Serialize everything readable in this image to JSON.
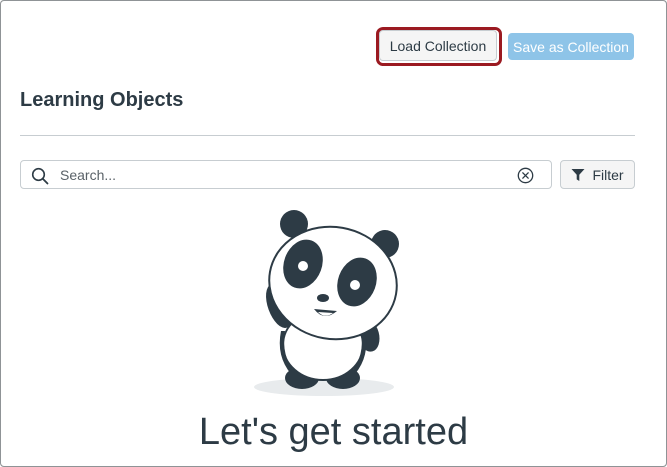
{
  "toolbar": {
    "load_label": "Load Collection",
    "save_label": "Save as Collection"
  },
  "page": {
    "title": "Learning Objects"
  },
  "search": {
    "placeholder": "Search...",
    "value": ""
  },
  "filter": {
    "label": "Filter"
  },
  "empty_state": {
    "heading": "Let's get started",
    "illustration": "panda-mascot"
  },
  "icons": {
    "search": "search-icon",
    "clear": "clear-icon",
    "filter": "filter-icon"
  },
  "colors": {
    "accent_disabled": "#8ec4e8",
    "highlight": "#9b1a21",
    "text": "#2d3b45",
    "border": "#c7cdd1"
  }
}
